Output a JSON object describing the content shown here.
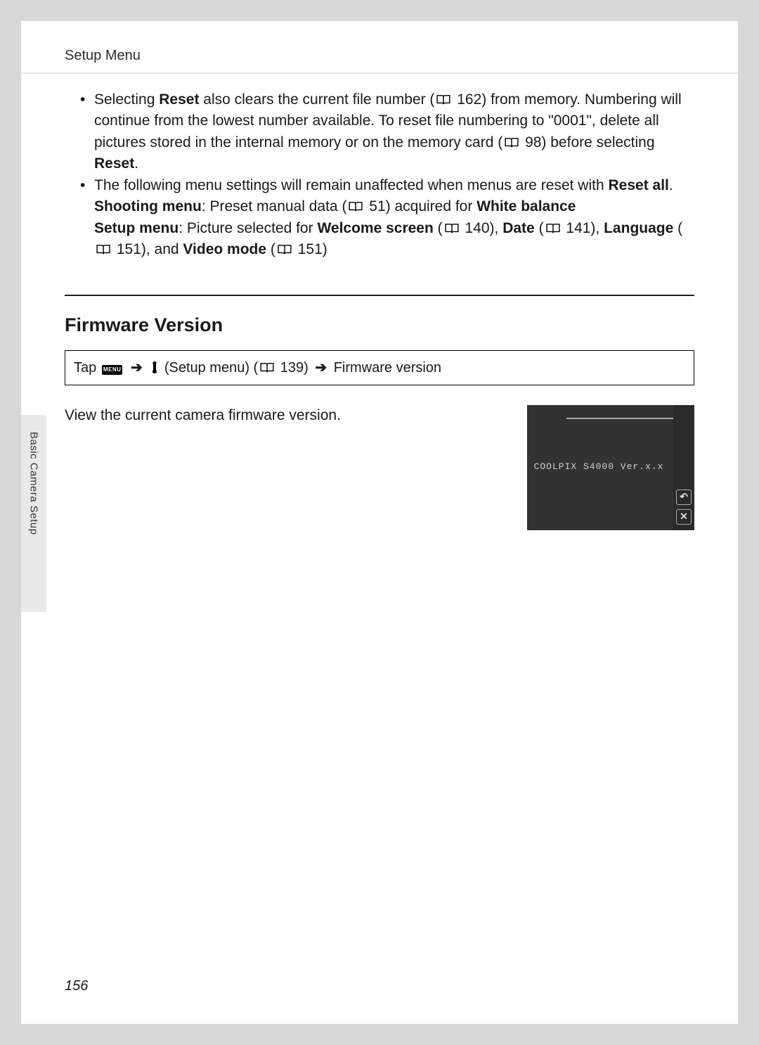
{
  "header": {
    "title": "Setup Menu"
  },
  "bullets": {
    "b1": {
      "pre": "Selecting ",
      "bold1": "Reset",
      "mid1": " also clears the current file number (",
      "ref1": " 162) from memory. Numbering will continue from the lowest number available. To reset file numbering to \"0001\", delete all pictures stored in the internal memory or on the memory card (",
      "ref2": " 98) before selecting ",
      "bold2": "Reset",
      "post": "."
    },
    "b2": {
      "line1": "The following menu settings will remain unaffected when menus are reset with ",
      "resetall": "Reset all",
      "dot1": ".",
      "shooting_label": "Shooting menu",
      "shooting_text": ": Preset manual data (",
      "shooting_ref": " 51) acquired for ",
      "whitebalance": "White balance",
      "setup_label": "Setup menu",
      "setup_text": ": Picture selected for ",
      "welcome": "Welcome screen",
      "welcome_ref_pre": " (",
      "welcome_ref": " 140), ",
      "date": "Date",
      "date_ref_pre": " (",
      "date_ref": " 141), ",
      "language": "Language",
      "language_ref_pre": " (",
      "language_ref": " 151), and ",
      "videomode": "Video mode",
      "videomode_ref_pre": " (",
      "videomode_ref": " 151)"
    }
  },
  "section": {
    "title": "Firmware Version"
  },
  "nav": {
    "tap": "Tap ",
    "menu_badge": "MENU",
    "setup_menu": " (Setup menu) (",
    "setup_ref": " 139) ",
    "firmware": " Firmware version"
  },
  "firmware": {
    "text": "View the current camera firmware version.",
    "screen_label": "COOLPIX S4000 Ver.x.x",
    "undo": "↶",
    "close": "✕"
  },
  "sidetab": {
    "text": "Basic Camera Setup"
  },
  "page_number": "156",
  "arrow": "➔"
}
